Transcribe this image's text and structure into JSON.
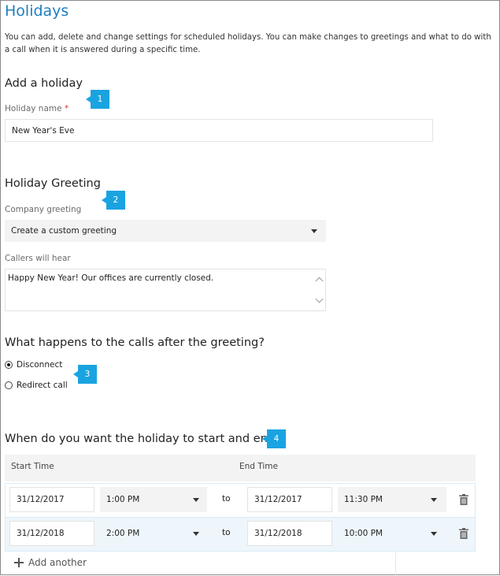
{
  "page": {
    "title": "Holidays",
    "description": "You can add, delete and change settings for scheduled holidays. You can make changes to greetings and what to do with a call when it is answered during a specific time."
  },
  "add_holiday": {
    "heading": "Add a holiday",
    "name_label": "Holiday name",
    "required_mark": "*",
    "name_value": "New Year's Eve",
    "callout": "1"
  },
  "greeting": {
    "heading": "Holiday Greeting",
    "company_label": "Company greeting",
    "company_value": "Create a custom greeting",
    "callers_label": "Callers will hear",
    "callers_value": "Happy New Year! Our offices are currently closed.",
    "callout": "2"
  },
  "after_greeting": {
    "heading": "What happens to the calls after the greeting?",
    "options": [
      "Disconnect",
      "Redirect call"
    ],
    "selected": "Disconnect",
    "callout": "3"
  },
  "schedule": {
    "heading": "When do you want the holiday to start and end?",
    "callout": "4",
    "start_header": "Start Time",
    "end_header": "End Time",
    "to_label": "to",
    "rows": [
      {
        "start_date": "31/12/2017",
        "start_time": "1:00 PM",
        "end_date": "31/12/2017",
        "end_time": "11:30 PM"
      },
      {
        "start_date": "31/12/2018",
        "start_time": "2:00 PM",
        "end_date": "31/12/2018",
        "end_time": "10:00 PM"
      }
    ],
    "add_another": "Add another",
    "add_icon": "plus-icon",
    "delete_icon": "trash-icon"
  },
  "colors": {
    "accent": "#1d7fc1",
    "callout": "#1aa3e1",
    "required": "#c0392b"
  }
}
